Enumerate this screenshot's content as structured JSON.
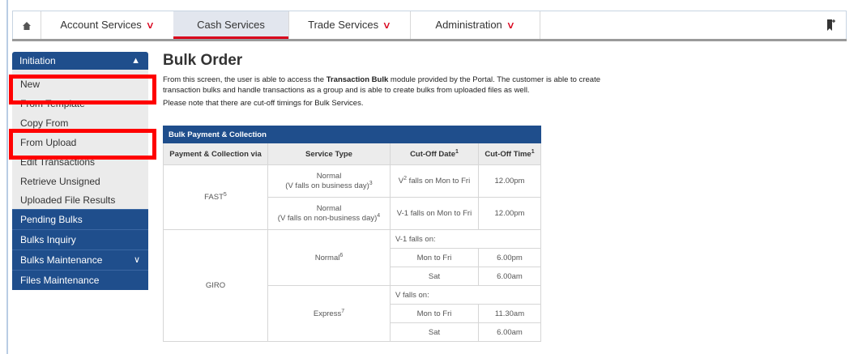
{
  "nav": {
    "home_icon": "home-icon",
    "items": [
      {
        "label": "Account Services",
        "chevron": "chevron-down-icon"
      },
      {
        "label": "Cash Services"
      },
      {
        "label": "Trade Services",
        "chevron": "chevron-down-icon"
      },
      {
        "label": "Administration",
        "chevron": "chevron-down-icon"
      }
    ],
    "bookmark_icon": "bookmark-plus-icon",
    "active_color": "#d9001b"
  },
  "sidebar": {
    "section": "Initiation",
    "sub_items": [
      "New",
      "From Template",
      "Copy From",
      "From Upload",
      "Edit Transactions",
      "Retrieve Unsigned",
      "Uploaded File Results"
    ],
    "items": [
      "Pending Bulks",
      "Bulks Inquiry",
      "Bulks Maintenance",
      "Files Maintenance"
    ],
    "accent": "#1f4e8c"
  },
  "main": {
    "title": "Bulk Order",
    "desc_pre": "From this screen, the user is able to access the ",
    "desc_bold": "Transaction Bulk",
    "desc_post": " module provided by the Portal. The customer is able to create transaction bulks and handle transactions as a group and is able to create bulks from uploaded files as well.",
    "note": "Please note that there are cut-off timings for Bulk Services."
  },
  "table": {
    "caption": "Bulk Payment & Collection",
    "headers": {
      "via": "Payment & Collection via",
      "service": "Service Type",
      "date": "Cut-Off Date",
      "date_sup": "1",
      "time": "Cut-Off Time",
      "time_sup": "1"
    },
    "fast": {
      "label": "FAST",
      "sup": "5",
      "r1": {
        "service": "Normal",
        "service_sub": "(V falls on business day)",
        "service_sup": "3",
        "date_pre": "V",
        "date_sup": "2",
        "date_post": " falls on Mon to Fri",
        "time": "12.00pm"
      },
      "r2": {
        "service": "Normal",
        "service_sub": "(V falls on non-business day)",
        "service_sup": "4",
        "date": "V-1 falls on Mon to Fri",
        "time": "12.00pm"
      }
    },
    "giro": {
      "label": "GIRO",
      "normal": {
        "label": "Normal",
        "sup": "6",
        "falls": "V-1 falls on:",
        "r1_day": "Mon to Fri",
        "r1_time": "6.00pm",
        "r2_day": "Sat",
        "r2_time": "6.00am"
      },
      "express": {
        "label": "Express",
        "sup": "7",
        "falls": "V falls on:",
        "r1_day": "Mon to Fri",
        "r1_time": "11.30am",
        "r2_day": "Sat",
        "r2_time": "6.00am"
      }
    }
  }
}
